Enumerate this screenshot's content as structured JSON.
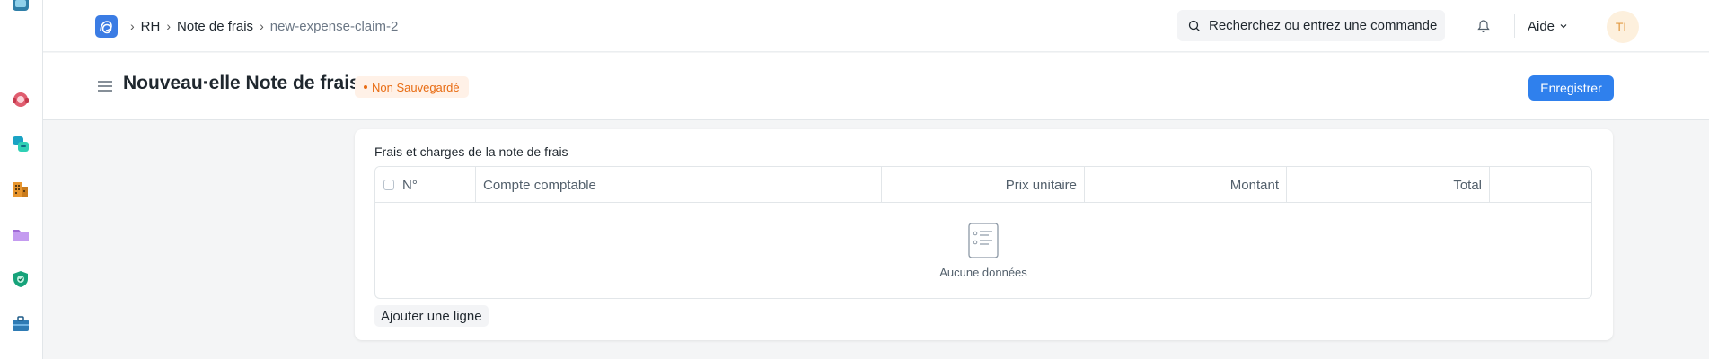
{
  "breadcrumbs": [
    {
      "label": "RH"
    },
    {
      "label": "Note de frais"
    },
    {
      "label": "new-expense-claim-2"
    }
  ],
  "search": {
    "placeholder": "Recherchez ou entrez une commande"
  },
  "help": {
    "label": "Aide"
  },
  "user": {
    "initials": "TL"
  },
  "page": {
    "title": "Nouveau·elle Note de frais",
    "status": "Non Sauvegardé",
    "save_label": "Enregistrer"
  },
  "expenses": {
    "section_label": "Frais et charges de la note de frais",
    "columns": {
      "no": "N°",
      "account": "Compte comptable",
      "unit_price": "Prix unitaire",
      "amount": "Montant",
      "total": "Total"
    },
    "empty_text": "Aucune données",
    "add_row_label": "Ajouter une ligne"
  },
  "sidebar_icons": [
    "app-icon-top",
    "help-desk-icon",
    "chat-icon",
    "organization-icon",
    "folder-icon",
    "security-icon",
    "briefcase-icon"
  ],
  "colors": {
    "primary": "#2f80ed",
    "unsaved_text": "#e86c13",
    "unsaved_bg": "#fff1e7",
    "avatar_bg": "#fdf0dd",
    "avatar_text": "#e29b45"
  }
}
